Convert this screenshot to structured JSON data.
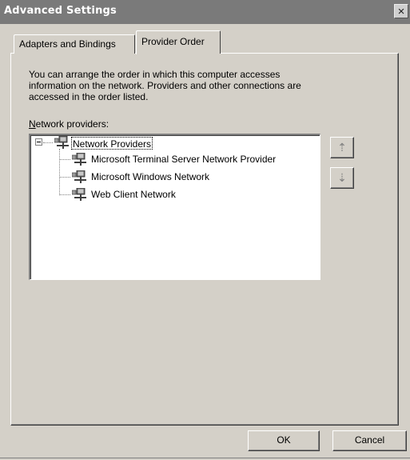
{
  "window": {
    "title": "Advanced Settings",
    "close_glyph": "×"
  },
  "tabs": [
    {
      "label": "Adapters and Bindings",
      "active": false
    },
    {
      "label": "Provider Order",
      "active": true
    }
  ],
  "panel": {
    "description_line1": "You can arrange the order in which this computer accesses",
    "description_line2": "information on the network.  Providers and other connections are",
    "description_line3": "accessed in the order listed.",
    "network_providers_label_accel": "N",
    "network_providers_label_rest": "etwork providers:"
  },
  "tree": {
    "root": {
      "label": "Network Providers",
      "icon": "network-icon",
      "expanded": true,
      "selected": true
    },
    "children": [
      {
        "label": "Microsoft Terminal Server Network Provider",
        "icon": "network-icon"
      },
      {
        "label": "Microsoft Windows Network",
        "icon": "network-icon"
      },
      {
        "label": "Web Client Network",
        "icon": "network-icon"
      }
    ]
  },
  "arrows": {
    "up_glyph": "⇡",
    "down_glyph": "⇣"
  },
  "buttons": {
    "ok": "OK",
    "cancel": "Cancel"
  }
}
